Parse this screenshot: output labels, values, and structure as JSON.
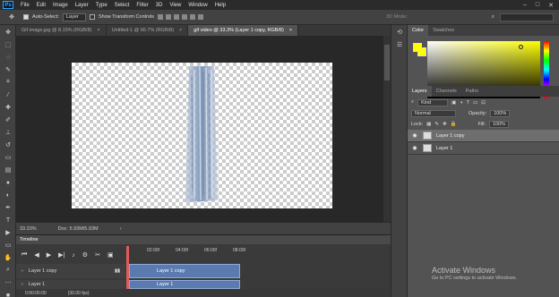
{
  "menubar": {
    "logo": "Ps",
    "items": [
      "File",
      "Edit",
      "Image",
      "Layer",
      "Type",
      "Select",
      "Filter",
      "3D",
      "View",
      "Window",
      "Help"
    ],
    "window_controls": [
      "–",
      "□",
      "✕"
    ]
  },
  "options": {
    "auto_select_label": "Auto-Select:",
    "auto_select_value": "Layer",
    "show_transform_label": "Show Transform Controls",
    "mode_3d": "3D Mode:"
  },
  "tabs": [
    {
      "label": "Gif image.jpg @ 8.15% (RGB/8)",
      "close": "×"
    },
    {
      "label": "Untitled-1 @ 66.7% (RGB/8)",
      "close": "×"
    },
    {
      "label": "gif video @ 33.3% (Layer 1 copy, RGB/8)",
      "close": "×"
    }
  ],
  "status": {
    "zoom": "33.33%",
    "doc": "Doc: 5.93M/5.93M"
  },
  "timeline": {
    "title": "Timeline",
    "ticks": [
      "02:00f",
      "04:00f",
      "06:00f",
      "08:00f"
    ],
    "layers": [
      {
        "name": "Layer 1 copy",
        "clip": "Layer 1 copy"
      },
      {
        "name": "Layer 1",
        "clip": "Layer 1"
      }
    ],
    "time": "0:00:00:00",
    "fps": "(30.00 fps)"
  },
  "color_panel": {
    "tabs": [
      "Color",
      "Swatches"
    ],
    "fg": "#ffff00",
    "bg": "#ffff00"
  },
  "layers_panel": {
    "tabs": [
      "Layers",
      "Channels",
      "Paths"
    ],
    "kind": "Kind",
    "blend": "Normal",
    "opacity_label": "Opacity:",
    "opacity_value": "100%",
    "lock_label": "Lock:",
    "fill_label": "Fill:",
    "fill_value": "100%",
    "items": [
      {
        "name": "Layer 1 copy",
        "active": true
      },
      {
        "name": "Layer 1",
        "active": false
      }
    ]
  },
  "watermark": {
    "title": "Activate Windows",
    "subtitle": "Go to PC settings to activate Windows."
  }
}
